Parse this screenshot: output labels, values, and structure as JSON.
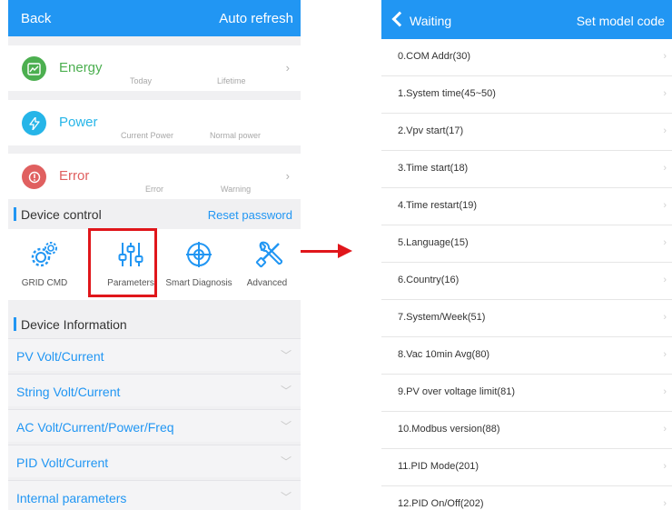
{
  "left": {
    "nav": {
      "back": "Back",
      "auto_refresh": "Auto refresh"
    },
    "energy": {
      "title": "Energy",
      "sub1": "Today",
      "sub2": "Lifetime",
      "color": "#4caf50"
    },
    "power": {
      "title": "Power",
      "sub1": "Current Power",
      "sub2": "Normal power",
      "color": "#26b5e8"
    },
    "error": {
      "title": "Error",
      "sub1": "Error",
      "sub2": "Warning",
      "color": "#e06060"
    },
    "device_control": {
      "label": "Device control",
      "reset": "Reset password"
    },
    "controls": [
      {
        "label": "GRID CMD",
        "icon": "gears-icon"
      },
      {
        "label": "Parameters",
        "icon": "sliders-icon"
      },
      {
        "label": "Smart Diagnosis",
        "icon": "crosshair-icon"
      },
      {
        "label": "Advanced",
        "icon": "wrench-screwdriver-icon"
      }
    ],
    "device_information": {
      "label": "Device Information"
    },
    "info_rows": [
      "PV Volt/Current",
      "String Volt/Current",
      "AC Volt/Current/Power/Freq",
      "PID Volt/Current",
      "Internal parameters"
    ],
    "info_chevron": "﹀"
  },
  "right": {
    "nav": {
      "waiting": "Waiting",
      "set_model": "Set model code"
    },
    "params": [
      "0.COM Addr(30)",
      "1.System time(45~50)",
      "2.Vpv start(17)",
      "3.Time start(18)",
      "4.Time restart(19)",
      "5.Language(15)",
      "6.Country(16)",
      "7.System/Week(51)",
      "8.Vac 10min Avg(80)",
      "9.PV over voltage limit(81)",
      "10.Modbus version(88)",
      "11.PID Mode(201)",
      "12.PID On/Off(202)"
    ],
    "chevron": "›"
  },
  "colors": {
    "accent": "#2196f3",
    "highlight": "#e0161b"
  }
}
